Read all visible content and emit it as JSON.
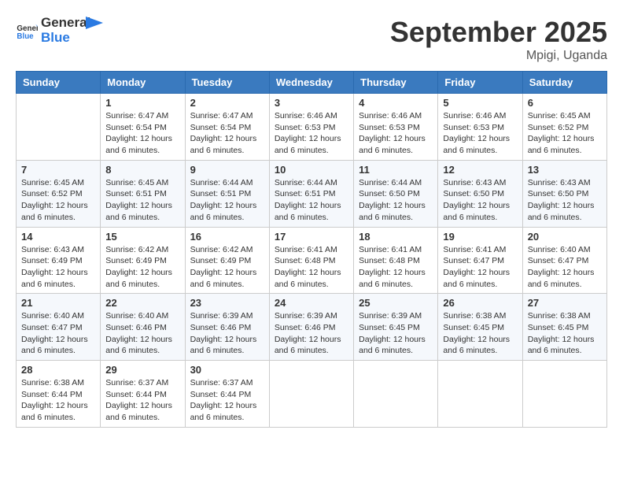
{
  "header": {
    "logo_general": "General",
    "logo_blue": "Blue",
    "month_title": "September 2025",
    "location": "Mpigi, Uganda"
  },
  "days_of_week": [
    "Sunday",
    "Monday",
    "Tuesday",
    "Wednesday",
    "Thursday",
    "Friday",
    "Saturday"
  ],
  "weeks": [
    [
      {
        "day": "",
        "info": ""
      },
      {
        "day": "1",
        "info": "Sunrise: 6:47 AM\nSunset: 6:54 PM\nDaylight: 12 hours\nand 6 minutes."
      },
      {
        "day": "2",
        "info": "Sunrise: 6:47 AM\nSunset: 6:54 PM\nDaylight: 12 hours\nand 6 minutes."
      },
      {
        "day": "3",
        "info": "Sunrise: 6:46 AM\nSunset: 6:53 PM\nDaylight: 12 hours\nand 6 minutes."
      },
      {
        "day": "4",
        "info": "Sunrise: 6:46 AM\nSunset: 6:53 PM\nDaylight: 12 hours\nand 6 minutes."
      },
      {
        "day": "5",
        "info": "Sunrise: 6:46 AM\nSunset: 6:53 PM\nDaylight: 12 hours\nand 6 minutes."
      },
      {
        "day": "6",
        "info": "Sunrise: 6:45 AM\nSunset: 6:52 PM\nDaylight: 12 hours\nand 6 minutes."
      }
    ],
    [
      {
        "day": "7",
        "info": "Sunrise: 6:45 AM\nSunset: 6:52 PM\nDaylight: 12 hours\nand 6 minutes."
      },
      {
        "day": "8",
        "info": "Sunrise: 6:45 AM\nSunset: 6:51 PM\nDaylight: 12 hours\nand 6 minutes."
      },
      {
        "day": "9",
        "info": "Sunrise: 6:44 AM\nSunset: 6:51 PM\nDaylight: 12 hours\nand 6 minutes."
      },
      {
        "day": "10",
        "info": "Sunrise: 6:44 AM\nSunset: 6:51 PM\nDaylight: 12 hours\nand 6 minutes."
      },
      {
        "day": "11",
        "info": "Sunrise: 6:44 AM\nSunset: 6:50 PM\nDaylight: 12 hours\nand 6 minutes."
      },
      {
        "day": "12",
        "info": "Sunrise: 6:43 AM\nSunset: 6:50 PM\nDaylight: 12 hours\nand 6 minutes."
      },
      {
        "day": "13",
        "info": "Sunrise: 6:43 AM\nSunset: 6:50 PM\nDaylight: 12 hours\nand 6 minutes."
      }
    ],
    [
      {
        "day": "14",
        "info": "Sunrise: 6:43 AM\nSunset: 6:49 PM\nDaylight: 12 hours\nand 6 minutes."
      },
      {
        "day": "15",
        "info": "Sunrise: 6:42 AM\nSunset: 6:49 PM\nDaylight: 12 hours\nand 6 minutes."
      },
      {
        "day": "16",
        "info": "Sunrise: 6:42 AM\nSunset: 6:49 PM\nDaylight: 12 hours\nand 6 minutes."
      },
      {
        "day": "17",
        "info": "Sunrise: 6:41 AM\nSunset: 6:48 PM\nDaylight: 12 hours\nand 6 minutes."
      },
      {
        "day": "18",
        "info": "Sunrise: 6:41 AM\nSunset: 6:48 PM\nDaylight: 12 hours\nand 6 minutes."
      },
      {
        "day": "19",
        "info": "Sunrise: 6:41 AM\nSunset: 6:47 PM\nDaylight: 12 hours\nand 6 minutes."
      },
      {
        "day": "20",
        "info": "Sunrise: 6:40 AM\nSunset: 6:47 PM\nDaylight: 12 hours\nand 6 minutes."
      }
    ],
    [
      {
        "day": "21",
        "info": "Sunrise: 6:40 AM\nSunset: 6:47 PM\nDaylight: 12 hours\nand 6 minutes."
      },
      {
        "day": "22",
        "info": "Sunrise: 6:40 AM\nSunset: 6:46 PM\nDaylight: 12 hours\nand 6 minutes."
      },
      {
        "day": "23",
        "info": "Sunrise: 6:39 AM\nSunset: 6:46 PM\nDaylight: 12 hours\nand 6 minutes."
      },
      {
        "day": "24",
        "info": "Sunrise: 6:39 AM\nSunset: 6:46 PM\nDaylight: 12 hours\nand 6 minutes."
      },
      {
        "day": "25",
        "info": "Sunrise: 6:39 AM\nSunset: 6:45 PM\nDaylight: 12 hours\nand 6 minutes."
      },
      {
        "day": "26",
        "info": "Sunrise: 6:38 AM\nSunset: 6:45 PM\nDaylight: 12 hours\nand 6 minutes."
      },
      {
        "day": "27",
        "info": "Sunrise: 6:38 AM\nSunset: 6:45 PM\nDaylight: 12 hours\nand 6 minutes."
      }
    ],
    [
      {
        "day": "28",
        "info": "Sunrise: 6:38 AM\nSunset: 6:44 PM\nDaylight: 12 hours\nand 6 minutes."
      },
      {
        "day": "29",
        "info": "Sunrise: 6:37 AM\nSunset: 6:44 PM\nDaylight: 12 hours\nand 6 minutes."
      },
      {
        "day": "30",
        "info": "Sunrise: 6:37 AM\nSunset: 6:44 PM\nDaylight: 12 hours\nand 6 minutes."
      },
      {
        "day": "",
        "info": ""
      },
      {
        "day": "",
        "info": ""
      },
      {
        "day": "",
        "info": ""
      },
      {
        "day": "",
        "info": ""
      }
    ]
  ]
}
